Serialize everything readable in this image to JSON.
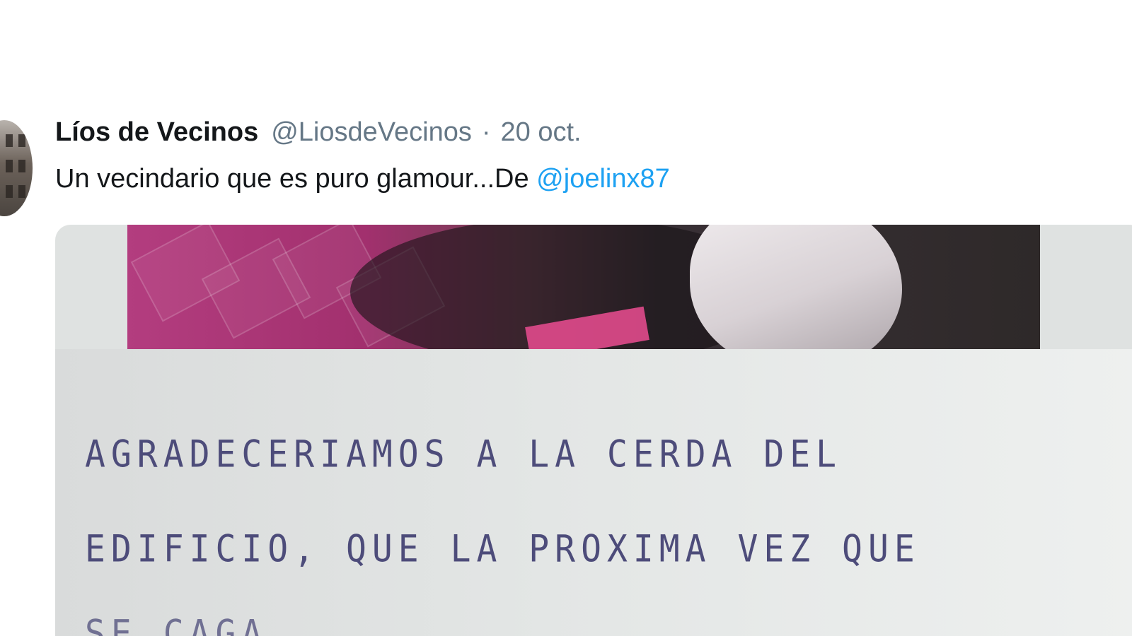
{
  "tweet": {
    "display_name": "Líos de Vecinos",
    "handle": "@LiosdeVecinos",
    "separator": "·",
    "date": "20 oct.",
    "text_before_mention": "Un vecindario que es puro glamour...De ",
    "mention": "@joelinx87"
  },
  "media": {
    "handwritten_lines": [
      "AGRADECERIAMOS A LA CERDA DEL",
      "EDIFICIO, QUE LA PROXIMA VEZ QUE",
      "SE CAGA"
    ]
  },
  "colors": {
    "text": "#14171a",
    "secondary_text": "#657786",
    "link": "#1da1f2",
    "handwriting": "#4d4c7a",
    "background": "#ffffff"
  }
}
